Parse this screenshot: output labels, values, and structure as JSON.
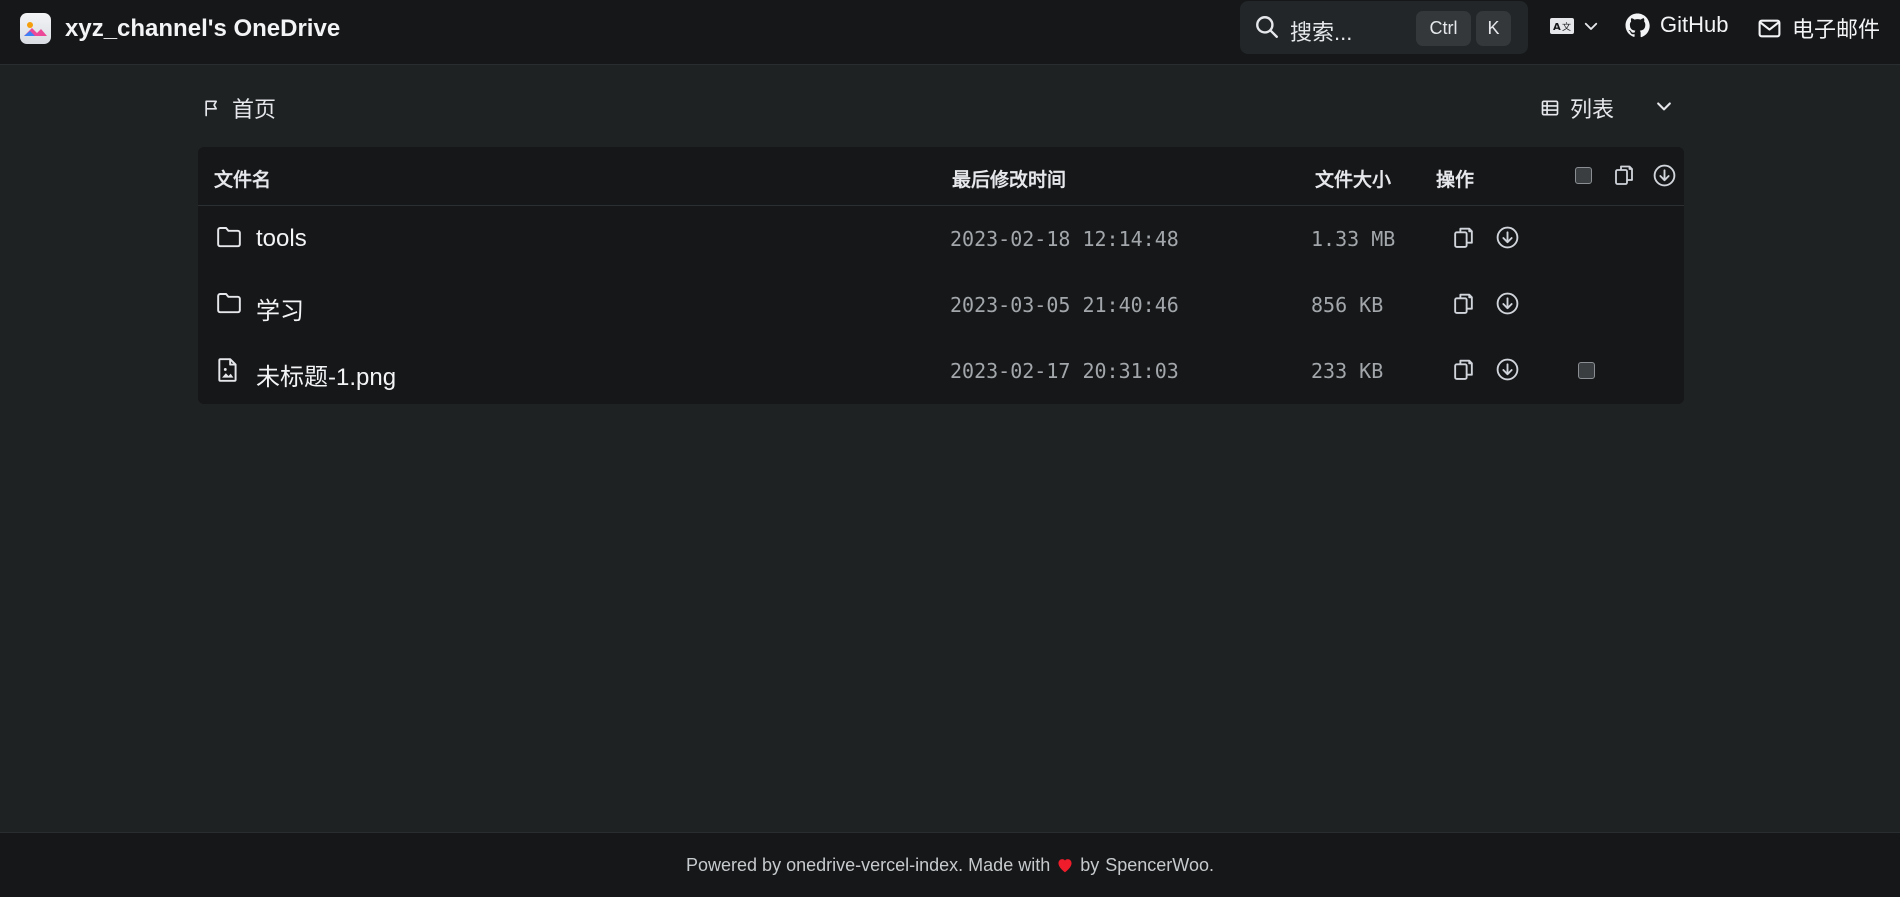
{
  "header": {
    "site_title": "xyz_channel's OneDrive",
    "search": {
      "placeholder": "搜索...",
      "shortcut_ctrl": "Ctrl",
      "shortcut_k": "K"
    },
    "github_label": "GitHub",
    "email_label": "电子邮件"
  },
  "toolbar": {
    "breadcrumb_home": "首页",
    "view_label": "列表"
  },
  "table": {
    "columns": {
      "name": "文件名",
      "modified": "最后修改时间",
      "size": "文件大小",
      "actions": "操作"
    },
    "rows": [
      {
        "type": "folder",
        "icon": "folder-icon",
        "name": "tools",
        "modified": "2023-02-18 12:14:48",
        "size": "1.33 MB",
        "selectable": false
      },
      {
        "type": "folder",
        "icon": "folder-icon",
        "name": "学习",
        "modified": "2023-03-05 21:40:46",
        "size": "856 KB",
        "selectable": false
      },
      {
        "type": "file",
        "icon": "image-file-icon",
        "name": "未标题-1.png",
        "modified": "2023-02-17 20:31:03",
        "size": "233 KB",
        "selectable": true
      }
    ]
  },
  "footer": {
    "prefix": "Powered by",
    "project_link": "onedrive-vercel-index",
    "made_with": ". Made with",
    "by": "by",
    "author_link": "SpencerWoo",
    "suffix": "."
  },
  "colors": {
    "background": "#1f2223",
    "surface": "#151718",
    "heart": "#ef1c2b",
    "muted_text": "#a3a7ab"
  }
}
